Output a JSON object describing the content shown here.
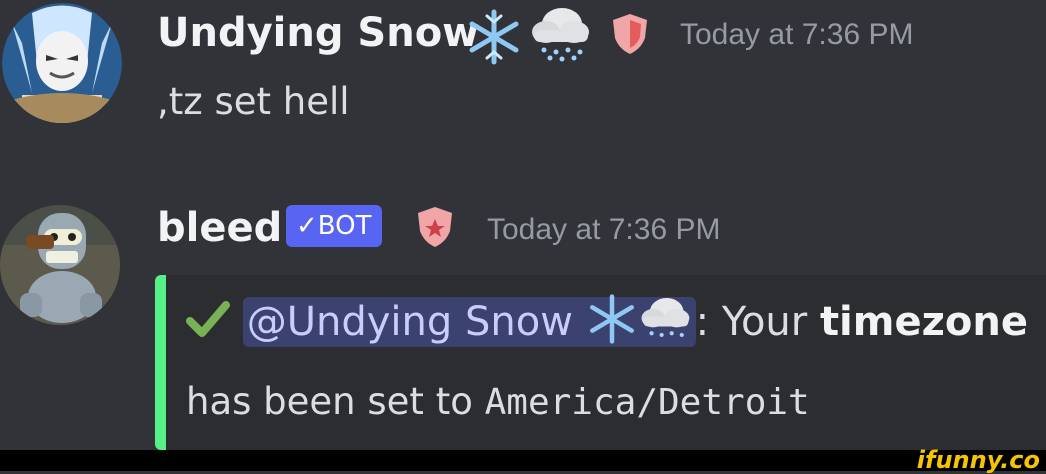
{
  "messages": [
    {
      "username": "Undying Snow",
      "badges": [
        "snowflake-emoji",
        "snow-cloud-emoji",
        "shield-icon"
      ],
      "timestamp": "Today at 7:36 PM",
      "content": ",tz set hell"
    },
    {
      "username": "bleed",
      "bot_tag": "✓BOT",
      "timestamp": "Today at 7:36 PM",
      "embed": {
        "accent_color": "#57f287",
        "mention": "@Undying Snow",
        "after_mention": ": Your ",
        "bold_word": "timezone",
        "line2_prefix": "has been set to ",
        "timezone_value": "America/Detroit"
      }
    }
  ],
  "watermark": "ifunny.co"
}
